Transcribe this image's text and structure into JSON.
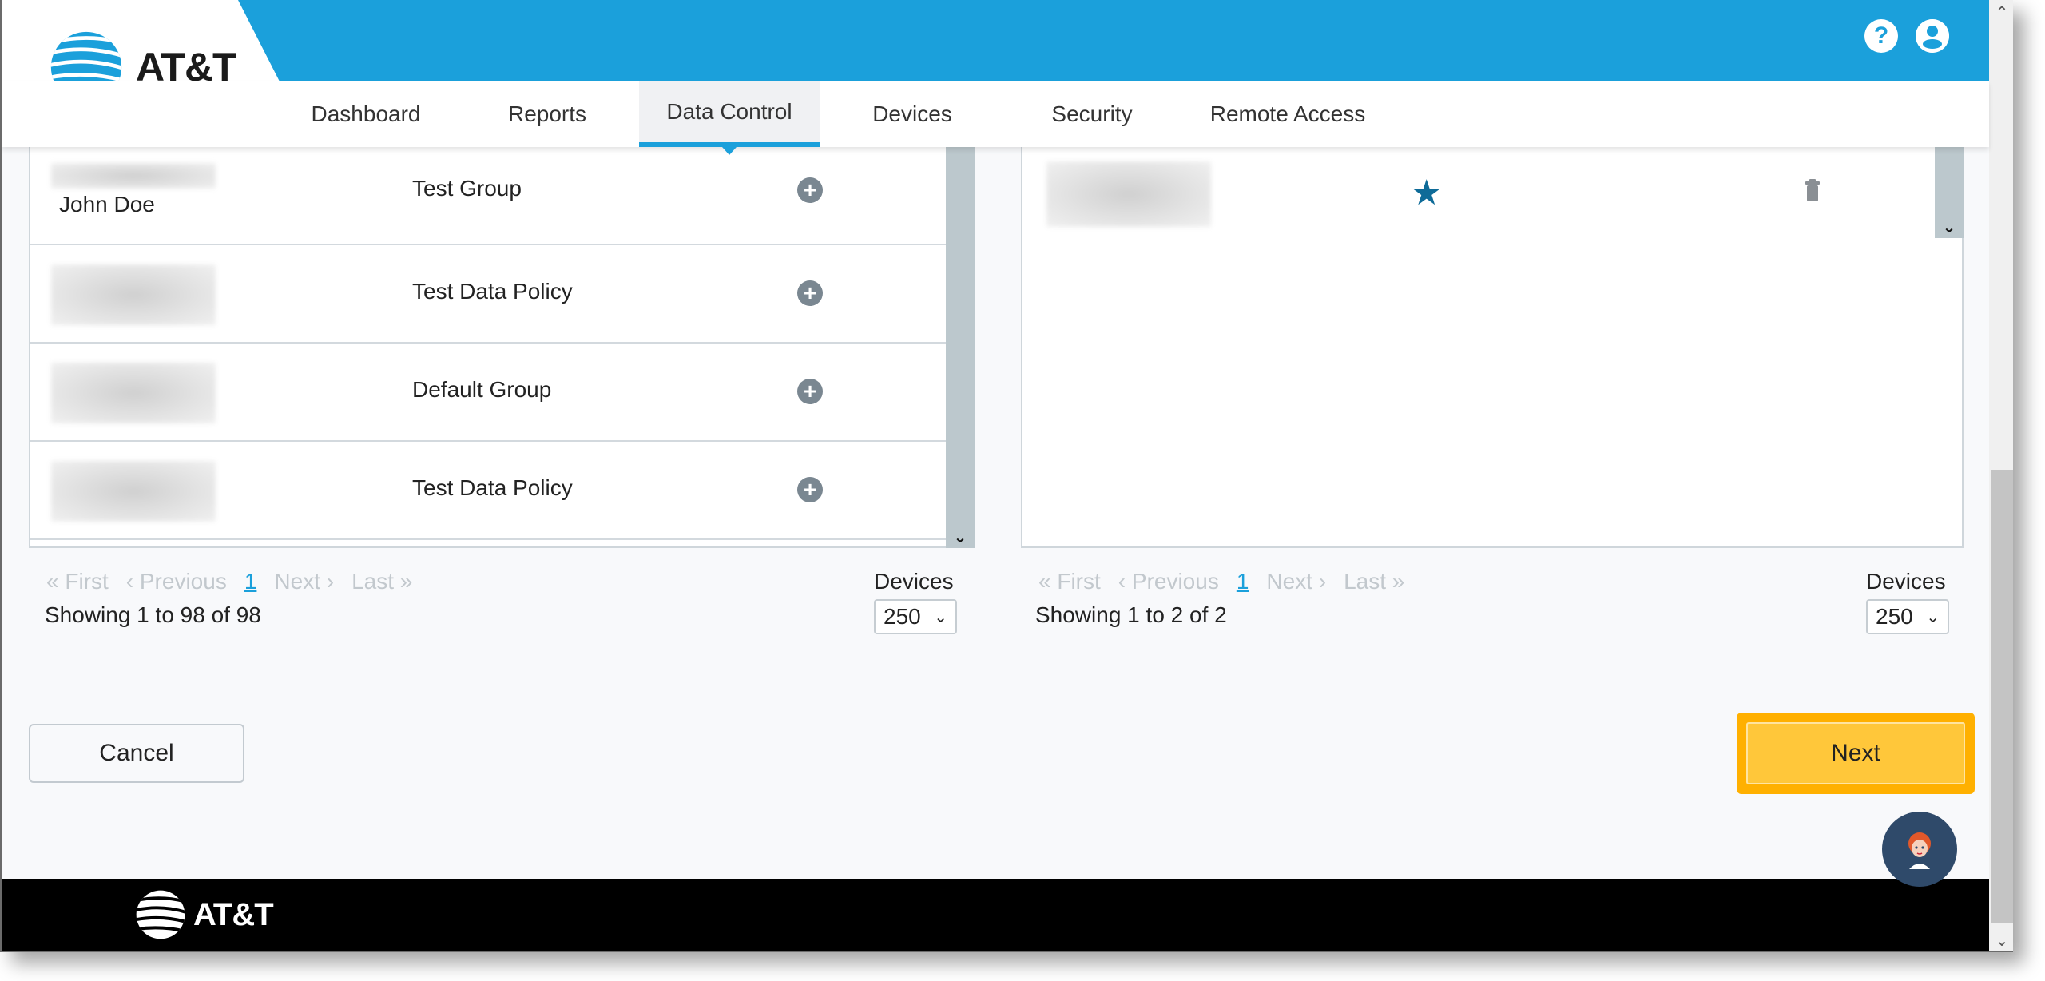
{
  "brand": {
    "name": "AT&T",
    "primary_color": "#1ba0db",
    "accent_color": "#ffb000"
  },
  "header": {
    "help_icon": "question-circle-icon",
    "user_icon": "user-circle-icon"
  },
  "nav": {
    "items": [
      {
        "label": "Dashboard",
        "active": false
      },
      {
        "label": "Reports",
        "active": false
      },
      {
        "label": "Data Control",
        "active": true
      },
      {
        "label": "Devices",
        "active": false
      },
      {
        "label": "Security",
        "active": false
      },
      {
        "label": "Remote Access",
        "active": false
      }
    ]
  },
  "left_panel": {
    "rows": [
      {
        "name": "John Doe",
        "group": "Test Group",
        "action_icon": "plus-circle-icon"
      },
      {
        "name": "",
        "group": "Test Data Policy",
        "action_icon": "plus-circle-icon"
      },
      {
        "name": "",
        "group": "Default Group",
        "action_icon": "plus-circle-icon"
      },
      {
        "name": "",
        "group": "Test Data Policy",
        "action_icon": "plus-circle-icon"
      }
    ],
    "pagination": {
      "first": "« First",
      "previous": "‹ Previous",
      "current_page": "1",
      "next": "Next ›",
      "last": "Last »"
    },
    "showing": "Showing 1 to 98 of 98",
    "per_page_label": "Devices",
    "per_page_value": "250"
  },
  "right_panel": {
    "rows": [
      {
        "name": "",
        "favorite_icon": "star-icon",
        "delete_icon": "trash-icon"
      }
    ],
    "pagination": {
      "first": "« First",
      "previous": "‹ Previous",
      "current_page": "1",
      "next": "Next ›",
      "last": "Last »"
    },
    "showing": "Showing 1 to 2 of 2",
    "per_page_label": "Devices",
    "per_page_value": "250"
  },
  "actions": {
    "cancel_label": "Cancel",
    "next_label": "Next"
  },
  "footer": {
    "logo_text": "AT&T"
  }
}
